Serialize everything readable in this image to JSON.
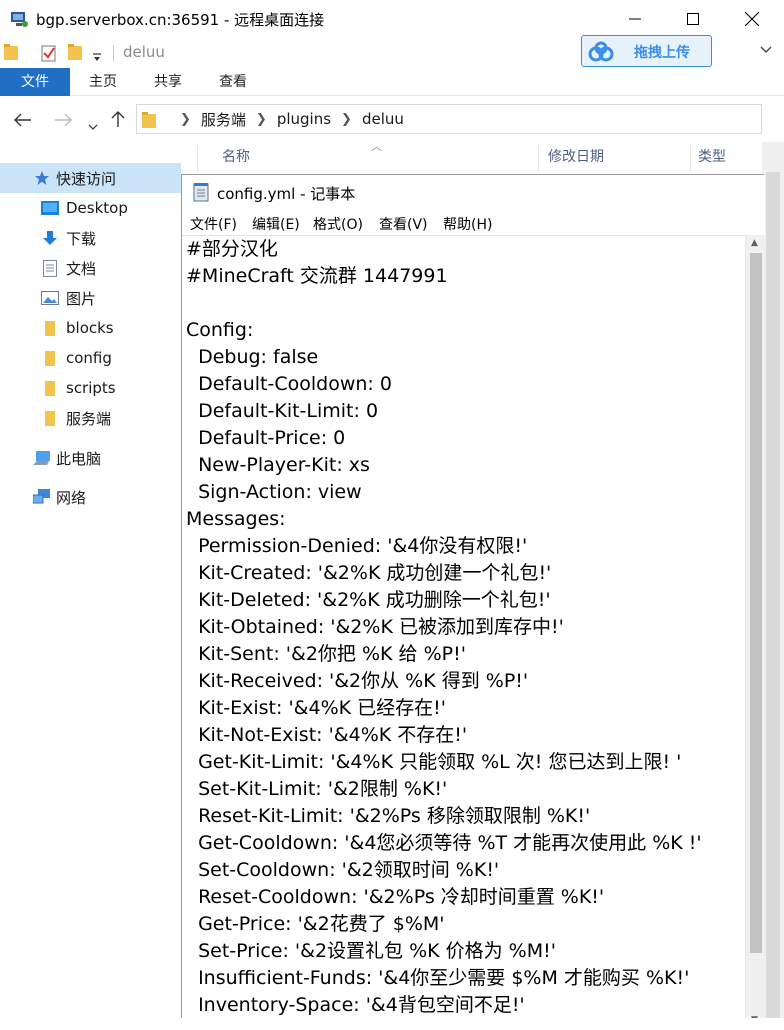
{
  "window": {
    "title": "bgp.serverbox.cn:36591 - 远程桌面连接"
  },
  "quick_access": {
    "folder_title": "deluu"
  },
  "upload_button": {
    "label": "拖拽上传",
    "accent": "#3b8ee8"
  },
  "ribbon": {
    "tabs": [
      "文件",
      "主页",
      "共享",
      "查看"
    ],
    "file_tab_color": "#1f6fc5"
  },
  "address": {
    "crumbs": [
      "服务端",
      "plugins",
      "deluu"
    ]
  },
  "columns": {
    "name": "名称",
    "modified": "修改日期",
    "type": "类型"
  },
  "nav": {
    "quick_access": "快速访问",
    "items": [
      "Desktop",
      "下载",
      "文档",
      "图片",
      "blocks",
      "config",
      "scripts",
      "服务端"
    ],
    "this_pc": "此电脑",
    "network": "网络"
  },
  "notepad": {
    "title": "config.yml - 记事本",
    "menu": [
      "文件(F)",
      "编辑(E)",
      "格式(O)",
      "查看(V)",
      "帮助(H)"
    ],
    "lines": [
      "#部分汉化",
      "#MineCraft 交流群 1447991",
      "",
      "Config:",
      "  Debug: false",
      "  Default-Cooldown: 0",
      "  Default-Kit-Limit: 0",
      "  Default-Price: 0",
      "  New-Player-Kit: xs",
      "  Sign-Action: view",
      "Messages:",
      "  Permission-Denied: '&4你没有权限!'",
      "  Kit-Created: '&2%K 成功创建一个礼包!'",
      "  Kit-Deleted: '&2%K 成功删除一个礼包!'",
      "  Kit-Obtained: '&2%K 已被添加到库存中!'",
      "  Kit-Sent: '&2你把 %K 给 %P!'",
      "  Kit-Received: '&2你从 %K 得到 %P!'",
      "  Kit-Exist: '&4%K 已经存在!'",
      "  Kit-Not-Exist: '&4%K 不存在!'",
      "  Get-Kit-Limit: '&4%K 只能领取 %L 次! 您已达到上限! '",
      "  Set-Kit-Limit: '&2限制 %K!'",
      "  Reset-Kit-Limit: '&2%Ps 移除领取限制 %K!'",
      "  Get-Cooldown: '&4您必须等待 %T 才能再次使用此 %K !'",
      "  Set-Cooldown: '&2领取时间 %K!'",
      "  Reset-Cooldown: '&2%Ps 冷却时间重置 %K!'",
      "  Get-Price: '&2花费了 $%M'",
      "  Set-Price: '&2设置礼包 %K 价格为 %M!'",
      "  Insufficient-Funds: '&4你至少需要 $%M 才能购买 %K!'",
      "  Inventory-Space: '&4背包空间不足!'"
    ]
  }
}
